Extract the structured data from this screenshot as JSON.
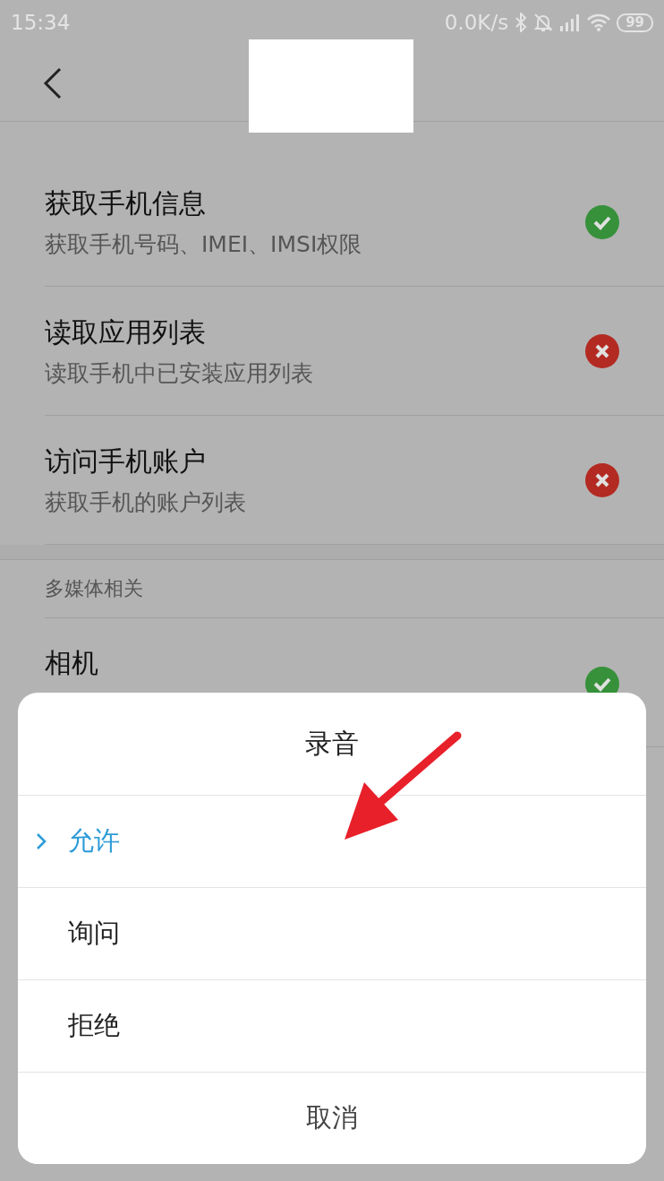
{
  "status_bar": {
    "time": "15:34",
    "speed": "0.0K/s",
    "battery": "99"
  },
  "permissions": [
    {
      "title": "获取手机信息",
      "subtitle": "获取手机号码、IMEI、IMSI权限",
      "allowed": true
    },
    {
      "title": "读取应用列表",
      "subtitle": "读取手机中已安装应用列表",
      "allowed": false
    },
    {
      "title": "访问手机账户",
      "subtitle": "获取手机的账户列表",
      "allowed": false
    }
  ],
  "section": {
    "title": "多媒体相关",
    "items": [
      {
        "title": "相机",
        "allowed": true
      }
    ]
  },
  "dialog": {
    "title": "录音",
    "options": [
      {
        "label": "允许",
        "selected": true
      },
      {
        "label": "询问",
        "selected": false
      },
      {
        "label": "拒绝",
        "selected": false
      }
    ],
    "cancel": "取消"
  }
}
